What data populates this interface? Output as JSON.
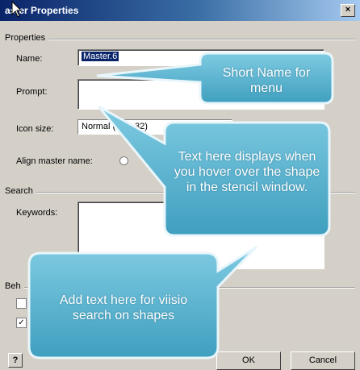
{
  "window": {
    "title": "aster Properties",
    "close_glyph": "×"
  },
  "properties_group": {
    "label": "Properties",
    "name_label": "Name:",
    "name_value": "Master.6",
    "prompt_label": "Prompt:",
    "prompt_value": "",
    "icon_size_label": "Icon size:",
    "icon_size_value": "Normal (32 x 32)",
    "align_label": "Align master name:"
  },
  "search_group": {
    "label": "Search",
    "keywords_label": "Keywords:",
    "keywords_value": ""
  },
  "behavior_group": {
    "label": "Beh"
  },
  "buttons": {
    "ok": "OK",
    "cancel": "Cancel",
    "help": "?"
  },
  "callouts": {
    "short_name": "Short Name for menu",
    "hover_text": "Text here displays when you hover over the shape in the stencil window.",
    "search_text": "Add text here for viisio search on shapes"
  },
  "colors": {
    "callout_fill": "#5fb8d4",
    "callout_stroke": "#2f8aa6",
    "title_bar": "#0a246a",
    "selection": "#0a246a"
  },
  "icons": [
    "cursor-arrow-icon",
    "close-icon",
    "dropdown-arrow-icon",
    "help-icon"
  ]
}
